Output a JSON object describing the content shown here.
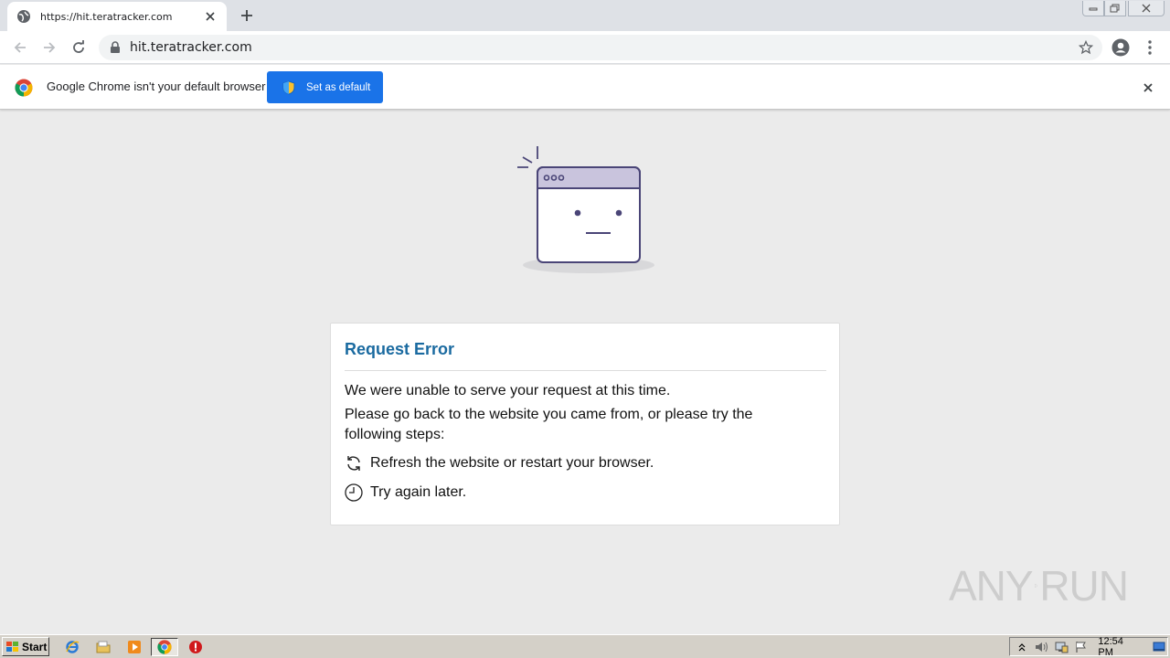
{
  "browser": {
    "tab": {
      "title": "https://hit.teratracker.com",
      "favicon": "globe-icon"
    },
    "new_tab_icon": "plus-icon",
    "toolbar": {
      "url": "hit.teratracker.com",
      "back_icon": "arrow-left-icon",
      "forward_icon": "arrow-right-icon",
      "reload_icon": "reload-icon",
      "secure_icon": "lock-icon",
      "bookmark_icon": "star-icon",
      "profile_icon": "account-circle-icon",
      "menu_icon": "kebab-menu-icon"
    },
    "infobar": {
      "message": "Google Chrome isn't your default browser",
      "button_label": "Set as default",
      "logo": "chrome-logo",
      "close_icon": "close-icon"
    }
  },
  "page": {
    "illustration": "sad-browser-window-icon",
    "error": {
      "title": "Request Error",
      "line1": "We were unable to serve your request at this time.",
      "line2": "Please go back to the website you came from, or please try the following steps:",
      "steps": [
        {
          "icon": "refresh-icon",
          "text": "Refresh the website or restart your browser."
        },
        {
          "icon": "clock-icon",
          "text": "Try again later."
        }
      ]
    }
  },
  "watermark": {
    "left": "ANY",
    "right": "RUN"
  },
  "taskbar": {
    "start_label": "Start",
    "clock": "12:54 PM",
    "pinned": [
      "internet-explorer-icon",
      "folder-icon",
      "media-player-icon",
      "chrome-icon",
      "stop-icon"
    ]
  },
  "colors": {
    "accent": "#1a73e8",
    "title_blue": "#1a6aa0",
    "page_bg": "#ebebeb",
    "illustration_stroke": "#4a4577"
  }
}
